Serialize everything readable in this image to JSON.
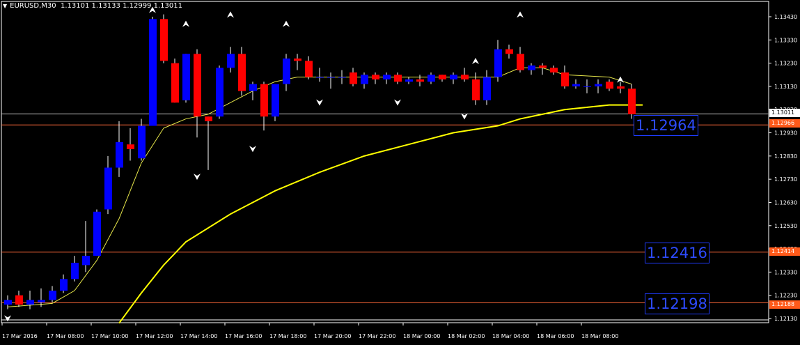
{
  "title": {
    "symbol_tf": "EURUSD,M30",
    "ohlc": "1.13101 1.13133 1.12999 1.13011"
  },
  "colors": {
    "background": "#000000",
    "bull_candle": "#0000ff",
    "bear_candle": "#ff0000",
    "axis_text": "#ffffff",
    "ma_fast": "#e6e64a",
    "ma_slow": "#ffff00",
    "h_line": "#ff6a3a",
    "bid_line": "#c8c8c8",
    "level_label_text": "#2d4bff"
  },
  "chart_data": {
    "type": "candlestick",
    "ylim": [
      1.121,
      1.1347
    ],
    "y_ticks": [
      "1.13430",
      "1.13330",
      "1.13230",
      "1.13130",
      "1.13030",
      "1.12930",
      "1.12830",
      "1.12730",
      "1.12630",
      "1.12530",
      "1.12430",
      "1.12330",
      "1.12230",
      "1.12130"
    ],
    "x_labels": [
      "17 Mar 2016",
      "17 Mar 08:00",
      "17 Mar 10:00",
      "17 Mar 12:00",
      "17 Mar 14:00",
      "17 Mar 16:00",
      "17 Mar 18:00",
      "17 Mar 20:00",
      "17 Mar 22:00",
      "18 Mar 00:00",
      "18 Mar 02:00",
      "18 Mar 04:00",
      "18 Mar 06:00",
      "18 Mar 08:00"
    ],
    "candles": [
      {
        "o": 1.1219,
        "h": 1.1223,
        "l": 1.1217,
        "c": 1.1221
      },
      {
        "o": 1.1223,
        "h": 1.1225,
        "l": 1.1218,
        "c": 1.1219
      },
      {
        "o": 1.1219,
        "h": 1.1225,
        "l": 1.1217,
        "c": 1.1221
      },
      {
        "o": 1.122,
        "h": 1.1226,
        "l": 1.1218,
        "c": 1.1221
      },
      {
        "o": 1.1221,
        "h": 1.1227,
        "l": 1.122,
        "c": 1.1225
      },
      {
        "o": 1.1225,
        "h": 1.1232,
        "l": 1.1224,
        "c": 1.123
      },
      {
        "o": 1.123,
        "h": 1.124,
        "l": 1.1229,
        "c": 1.1237
      },
      {
        "o": 1.1236,
        "h": 1.1255,
        "l": 1.1233,
        "c": 1.124
      },
      {
        "o": 1.124,
        "h": 1.126,
        "l": 1.124,
        "c": 1.1259
      },
      {
        "o": 1.126,
        "h": 1.1283,
        "l": 1.1258,
        "c": 1.1278
      },
      {
        "o": 1.1278,
        "h": 1.1298,
        "l": 1.1274,
        "c": 1.1289
      },
      {
        "o": 1.1288,
        "h": 1.1295,
        "l": 1.1281,
        "c": 1.1286
      },
      {
        "o": 1.1282,
        "h": 1.1299,
        "l": 1.1281,
        "c": 1.1296
      },
      {
        "o": 1.1296,
        "h": 1.1343,
        "l": 1.1296,
        "c": 1.1342
      },
      {
        "o": 1.1342,
        "h": 1.1344,
        "l": 1.1323,
        "c": 1.1324
      },
      {
        "o": 1.1323,
        "h": 1.1325,
        "l": 1.1306,
        "c": 1.1306
      },
      {
        "o": 1.1307,
        "h": 1.1327,
        "l": 1.1306,
        "c": 1.1327
      },
      {
        "o": 1.1327,
        "h": 1.1329,
        "l": 1.1291,
        "c": 1.13
      },
      {
        "o": 1.13,
        "h": 1.13,
        "l": 1.1277,
        "c": 1.1298
      },
      {
        "o": 1.13,
        "h": 1.1322,
        "l": 1.1299,
        "c": 1.1321
      },
      {
        "o": 1.1321,
        "h": 1.133,
        "l": 1.1319,
        "c": 1.1327
      },
      {
        "o": 1.1327,
        "h": 1.133,
        "l": 1.1309,
        "c": 1.1311
      },
      {
        "o": 1.1311,
        "h": 1.1315,
        "l": 1.1307,
        "c": 1.1314
      },
      {
        "o": 1.1314,
        "h": 1.1315,
        "l": 1.1294,
        "c": 1.13
      },
      {
        "o": 1.13,
        "h": 1.1314,
        "l": 1.1298,
        "c": 1.1314
      },
      {
        "o": 1.1314,
        "h": 1.1327,
        "l": 1.1311,
        "c": 1.1325
      },
      {
        "o": 1.1325,
        "h": 1.1327,
        "l": 1.132,
        "c": 1.1324
      },
      {
        "o": 1.1324,
        "h": 1.1326,
        "l": 1.1316,
        "c": 1.1317
      },
      {
        "o": 1.1317,
        "h": 1.1321,
        "l": 1.1315,
        "c": 1.1317
      },
      {
        "o": 1.1317,
        "h": 1.1319,
        "l": 1.1312,
        "c": 1.1317
      },
      {
        "o": 1.1317,
        "h": 1.132,
        "l": 1.1314,
        "c": 1.1317
      },
      {
        "o": 1.1319,
        "h": 1.1321,
        "l": 1.1313,
        "c": 1.1314
      },
      {
        "o": 1.1314,
        "h": 1.1319,
        "l": 1.1312,
        "c": 1.1318
      },
      {
        "o": 1.1318,
        "h": 1.1319,
        "l": 1.1314,
        "c": 1.1316
      },
      {
        "o": 1.1316,
        "h": 1.1319,
        "l": 1.1314,
        "c": 1.1318
      },
      {
        "o": 1.1318,
        "h": 1.1319,
        "l": 1.1314,
        "c": 1.1315
      },
      {
        "o": 1.1315,
        "h": 1.1317,
        "l": 1.1314,
        "c": 1.1316
      },
      {
        "o": 1.1316,
        "h": 1.1318,
        "l": 1.1313,
        "c": 1.1315
      },
      {
        "o": 1.1315,
        "h": 1.1319,
        "l": 1.1314,
        "c": 1.1318
      },
      {
        "o": 1.1318,
        "h": 1.1318,
        "l": 1.1315,
        "c": 1.1316
      },
      {
        "o": 1.1316,
        "h": 1.1319,
        "l": 1.1314,
        "c": 1.1318
      },
      {
        "o": 1.1318,
        "h": 1.1321,
        "l": 1.1315,
        "c": 1.1316
      },
      {
        "o": 1.1316,
        "h": 1.1319,
        "l": 1.1305,
        "c": 1.1307
      },
      {
        "o": 1.1307,
        "h": 1.132,
        "l": 1.1305,
        "c": 1.1317
      },
      {
        "o": 1.1317,
        "h": 1.1333,
        "l": 1.1315,
        "c": 1.1329
      },
      {
        "o": 1.1329,
        "h": 1.1331,
        "l": 1.1325,
        "c": 1.1327
      },
      {
        "o": 1.1327,
        "h": 1.133,
        "l": 1.1319,
        "c": 1.132
      },
      {
        "o": 1.132,
        "h": 1.1323,
        "l": 1.1318,
        "c": 1.1322
      },
      {
        "o": 1.1322,
        "h": 1.1323,
        "l": 1.1318,
        "c": 1.1321
      },
      {
        "o": 1.1321,
        "h": 1.1322,
        "l": 1.1318,
        "c": 1.1319
      },
      {
        "o": 1.1319,
        "h": 1.1322,
        "l": 1.1312,
        "c": 1.1313
      },
      {
        "o": 1.1313,
        "h": 1.1316,
        "l": 1.1312,
        "c": 1.1314
      },
      {
        "o": 1.1313,
        "h": 1.1316,
        "l": 1.131,
        "c": 1.1313
      },
      {
        "o": 1.1313,
        "h": 1.1316,
        "l": 1.131,
        "c": 1.1314
      },
      {
        "o": 1.1315,
        "h": 1.1316,
        "l": 1.1311,
        "c": 1.1312
      },
      {
        "o": 1.1313,
        "h": 1.1315,
        "l": 1.131,
        "c": 1.1312
      },
      {
        "o": 1.1312,
        "h": 1.1314,
        "l": 1.1299,
        "c": 1.1301
      }
    ],
    "ma_fast": [
      [
        0,
        1.1218
      ],
      [
        4,
        1.12195
      ],
      [
        6,
        1.1225
      ],
      [
        8,
        1.1238
      ],
      [
        10,
        1.1256
      ],
      [
        12,
        1.128
      ],
      [
        14,
        1.1295
      ],
      [
        16,
        1.1299
      ],
      [
        18,
        1.1301
      ],
      [
        20,
        1.1306
      ],
      [
        22,
        1.1311
      ],
      [
        24,
        1.1315
      ],
      [
        26,
        1.1317
      ],
      [
        30,
        1.1317
      ],
      [
        40,
        1.1317
      ],
      [
        44,
        1.1317
      ],
      [
        46,
        1.1321
      ],
      [
        48,
        1.1321
      ],
      [
        50,
        1.1318
      ],
      [
        54,
        1.1317
      ],
      [
        56,
        1.1314
      ]
    ],
    "ma_slow": [
      [
        10,
        1.1211
      ],
      [
        12,
        1.1224
      ],
      [
        14,
        1.1236
      ],
      [
        16,
        1.1246
      ],
      [
        20,
        1.1258
      ],
      [
        24,
        1.1268
      ],
      [
        28,
        1.1276
      ],
      [
        32,
        1.1283
      ],
      [
        36,
        1.1288
      ],
      [
        40,
        1.1293
      ],
      [
        44,
        1.1296
      ],
      [
        46,
        1.1299
      ],
      [
        50,
        1.1303
      ],
      [
        54,
        1.1305
      ],
      [
        57,
        1.1305
      ]
    ],
    "arrows_up": [
      [
        13,
        1.1344
      ],
      [
        16,
        1.1338
      ],
      [
        20,
        1.1342
      ],
      [
        25,
        1.1338
      ],
      [
        42,
        1.1322
      ],
      [
        46,
        1.1342
      ],
      [
        55,
        1.1314
      ]
    ],
    "arrows_down": [
      [
        0,
        1.1215
      ],
      [
        17,
        1.1276
      ],
      [
        22,
        1.1288
      ],
      [
        28,
        1.1308
      ],
      [
        35,
        1.1308
      ],
      [
        41,
        1.1302
      ]
    ],
    "h_levels": [
      {
        "price": 1.12964,
        "label": "1.12964",
        "axis_tag": "1.12966"
      },
      {
        "price": 1.12416,
        "label": "1.12416",
        "axis_tag": "1.12414"
      },
      {
        "price": 1.12198,
        "label": "1.12198",
        "axis_tag": "1.12188"
      }
    ],
    "bid_line": {
      "price": 1.13011,
      "axis_tag": "1.13011"
    }
  }
}
